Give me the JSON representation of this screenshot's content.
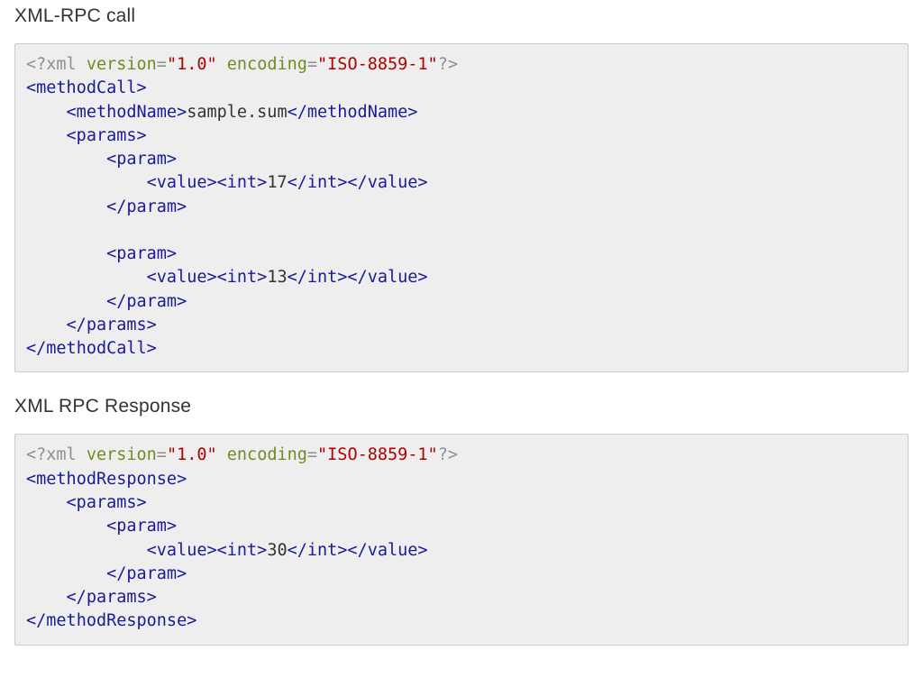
{
  "sections": [
    {
      "title": "XML-RPC call"
    },
    {
      "title": "XML RPC Response"
    }
  ],
  "xml": {
    "decl": {
      "raw_open": "<?xml ",
      "version_attr": "version",
      "version_val": "\"1.0\"",
      "encoding_attr": "encoding",
      "encoding_val": "\"ISO-8859-1\"",
      "raw_close": "?>"
    },
    "call": {
      "root_open": "<methodCall>",
      "root_close": "</methodCall>",
      "methodName_open": "<methodName>",
      "methodName_text": "sample.sum",
      "methodName_close": "</methodName>",
      "params_open": "<params>",
      "params_close": "</params>",
      "param_open": "<param>",
      "param_close": "</param>",
      "value_open": "<value>",
      "value_close": "</value>",
      "int_open": "<int>",
      "int_close": "</int>",
      "int1": "17",
      "int2": "13"
    },
    "resp": {
      "root_open": "<methodResponse>",
      "root_close": "</methodResponse>",
      "params_open": "<params>",
      "params_close": "</params>",
      "param_open": "<param>",
      "param_close": "</param>",
      "value_open": "<value>",
      "value_close": "</value>",
      "int_open": "<int>",
      "int_close": "</int>",
      "int1": "30"
    }
  }
}
